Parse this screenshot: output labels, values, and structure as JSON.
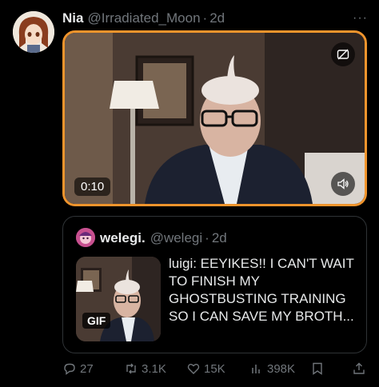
{
  "tweet": {
    "author_name": "Nia",
    "author_handle": "@Irradiated_Moon",
    "separator": "·",
    "time": "2d",
    "more_label": "···"
  },
  "video": {
    "duration": "0:10"
  },
  "quote": {
    "author_name": "welegi.",
    "author_handle": "@welegi",
    "separator": "·",
    "time": "2d",
    "badge": "GIF",
    "text": "luigi: EEYIKES!! I CAN'T WAIT TO FINISH MY GHOSTBUSTING TRAINING SO I CAN SAVE MY BROTH..."
  },
  "actions": {
    "replies": "27",
    "reposts": "3.1K",
    "likes": "15K",
    "views": "398K"
  },
  "colors": {
    "background": "#000000",
    "accent_border": "#f0942c",
    "muted_text": "#71767b",
    "text": "#e7e9ea"
  }
}
